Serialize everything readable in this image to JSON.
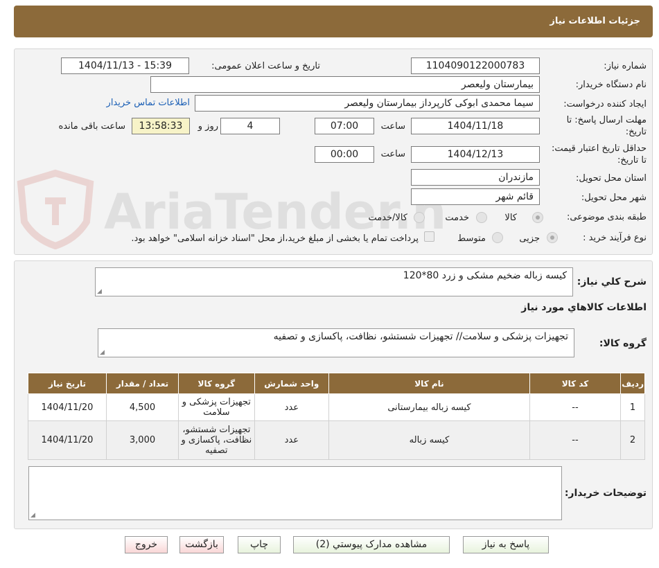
{
  "header": {
    "title": "جزئیات اطلاعات نیاز"
  },
  "form": {
    "need_number_label": "شماره نیاز:",
    "need_number": "1104090122000783",
    "announce_label": "تاریخ و ساعت اعلان عمومی:",
    "announce_value": "1404/11/13 - 15:39",
    "buyer_org_label": "نام دستگاه خریدار:",
    "buyer_org": "بیمارستان ولیعصر",
    "requester_label": "ایجاد کننده درخواست:",
    "requester": "سیما محمدی ابوکی کارپرداز بیمارستان ولیعصر",
    "contact_link": "اطلاعات تماس خریدار",
    "deadline_label": "مهلت ارسال پاسخ: تا تاریخ:",
    "deadline_date": "1404/11/18",
    "time_label": "ساعت",
    "deadline_time": "07:00",
    "days_value": "4",
    "days_label": "روز و",
    "remaining_time": "13:58:33",
    "remaining_label": "ساعت باقی مانده",
    "validity_label": "حداقل تاریخ اعتبار قیمت: تا تاریخ:",
    "validity_date": "1404/12/13",
    "validity_time": "00:00",
    "province_label": "استان محل تحویل:",
    "province": "مازندران",
    "city_label": "شهر محل تحویل:",
    "city": "قائم شهر",
    "category_label": "طبقه بندی موضوعی:",
    "category_options": [
      "کالا",
      "خدمت",
      "کالا/خدمت"
    ],
    "process_label": "نوع فرآیند خرید :",
    "process_options": [
      "جزیی",
      "متوسط"
    ],
    "payment_note": "پرداخت تمام یا بخشی از مبلغ خرید،از محل \"اسناد خزانه اسلامی\" خواهد بود."
  },
  "details": {
    "summary_label": "شرح کلي نياز:",
    "summary_value": "کیسه زباله ضخیم مشکی و زرد 80*120",
    "goods_info_title": "اطلاعات کالاهاي مورد نياز",
    "goods_group_label": "گروه کالا:",
    "goods_group_value": "تجهیزات پزشکی و سلامت// تجهیزات شستشو، نظافت، پاکسازی و تصفیه",
    "buyer_notes_label": "توضیحات خریدار:"
  },
  "table": {
    "headers": [
      "ردیف",
      "کد کالا",
      "نام کالا",
      "واحد شمارش",
      "گروه کالا",
      "تعداد / مقدار",
      "تاریخ نیاز"
    ],
    "rows": [
      [
        "1",
        "--",
        "کیسه زباله بیمارستانی",
        "عدد",
        "تجهیزات پزشکی و سلامت",
        "4,500",
        "1404/11/20"
      ],
      [
        "2",
        "--",
        "کیسه زباله",
        "عدد",
        "تجهیزات شستشو، نظافت، پاکسازی و تصفیه",
        "3,000",
        "1404/11/20"
      ]
    ]
  },
  "buttons": {
    "reply": "پاسخ به نیاز",
    "attachments": "مشاهده مدارک پیوستي (2)",
    "print": "چاپ",
    "back": "بازگشت",
    "exit": "خروج"
  },
  "watermark": {
    "text": "AriaTender.neT"
  },
  "colors": {
    "header_bg": "#8c6a3a",
    "link": "#1b5fb5",
    "timer_bg": "#f7f3c8"
  }
}
